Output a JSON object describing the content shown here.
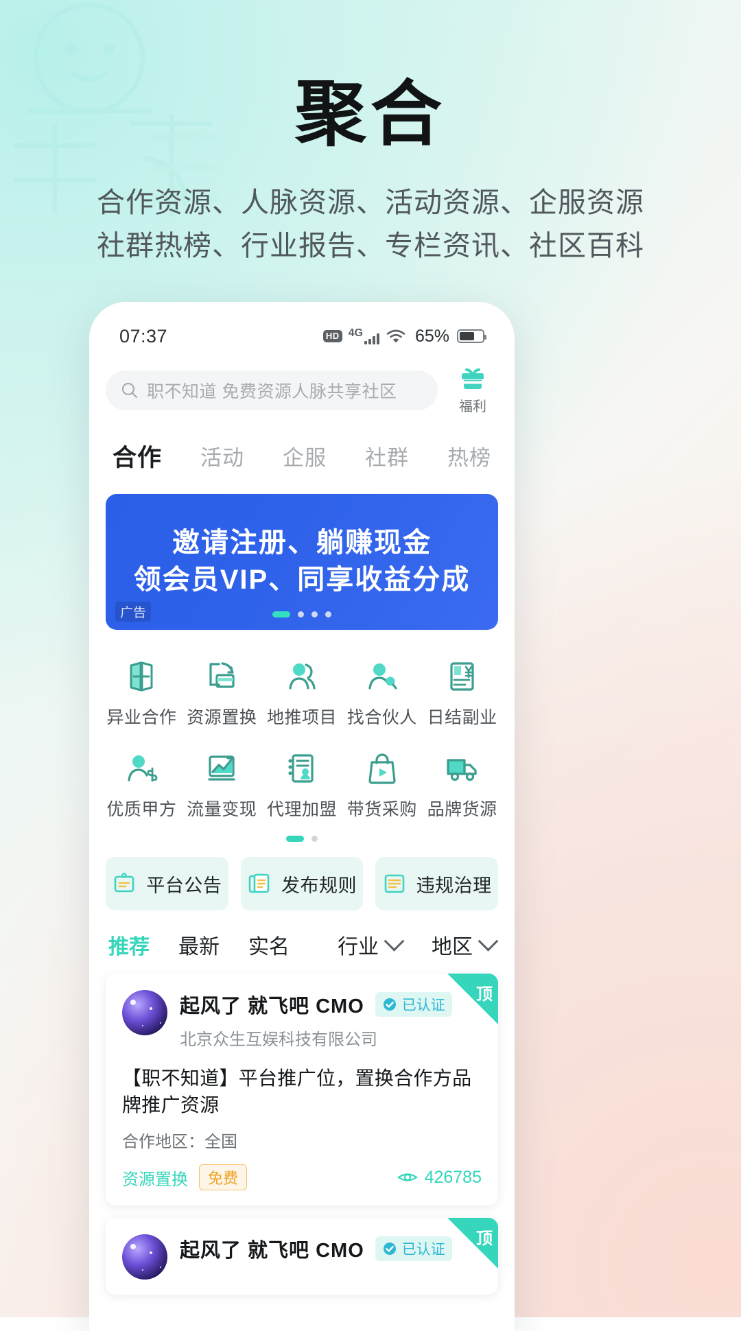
{
  "hero": {
    "title": "聚合",
    "subtitle_line1": "合作资源、人脉资源、活动资源、企服资源",
    "subtitle_line2": "社群热榜、行业报告、专栏资讯、社区百科"
  },
  "statusbar": {
    "time": "07:37",
    "hd": "HD",
    "network": "4G",
    "battery_percent": "65%"
  },
  "search": {
    "placeholder": "职不知道 免费资源人脉共享社区",
    "welfare_label": "福利"
  },
  "tabs": [
    {
      "label": "合作",
      "active": true
    },
    {
      "label": "活动",
      "active": false
    },
    {
      "label": "企服",
      "active": false
    },
    {
      "label": "社群",
      "active": false
    },
    {
      "label": "热榜",
      "active": false
    }
  ],
  "banner": {
    "line1": "邀请注册、躺赚现金",
    "line2": "领会员VIP、同享收益分成",
    "ad_tag": "广告",
    "dots": 4,
    "active_dot": 0,
    "bg_color": "#2f62ea"
  },
  "grid": {
    "items": [
      {
        "label": "异业合作",
        "icon": "exchange-flag-icon"
      },
      {
        "label": "资源置换",
        "icon": "swap-card-icon"
      },
      {
        "label": "地推项目",
        "icon": "two-people-icon"
      },
      {
        "label": "找合伙人",
        "icon": "person-search-icon"
      },
      {
        "label": "日结副业",
        "icon": "yen-note-icon"
      },
      {
        "label": "优质甲方",
        "icon": "person-dollar-icon"
      },
      {
        "label": "流量变现",
        "icon": "trend-chart-icon"
      },
      {
        "label": "代理加盟",
        "icon": "resume-person-icon"
      },
      {
        "label": "带货采购",
        "icon": "shop-bag-play-icon"
      },
      {
        "label": "品牌货源",
        "icon": "truck-icon"
      }
    ],
    "pages": 2,
    "active_page": 0,
    "accent_color": "#35d6bb"
  },
  "quick_links": [
    {
      "label": "平台公告",
      "icon": "clipboard-icon"
    },
    {
      "label": "发布规则",
      "icon": "documents-icon"
    },
    {
      "label": "违规治理",
      "icon": "list-doc-icon"
    }
  ],
  "filter": {
    "sorts": [
      {
        "label": "推荐",
        "active": true
      },
      {
        "label": "最新",
        "active": false
      },
      {
        "label": "实名",
        "active": false
      }
    ],
    "dropdowns": [
      {
        "label": "行业"
      },
      {
        "label": "地区"
      }
    ]
  },
  "posts": [
    {
      "corner_badge": "顶",
      "username": "起风了 就飞吧  CMO",
      "verified_label": "已认证",
      "company": "北京众生互娱科技有限公司",
      "title": "【职不知道】平台推广位，置换合作方品牌推广资源",
      "region": "合作地区：全国",
      "tag": "资源置换",
      "price_tag": "免费",
      "views": "426785"
    },
    {
      "corner_badge": "顶",
      "username": "起风了 就飞吧  CMO",
      "verified_label": "已认证",
      "company": "",
      "title": "",
      "region": "",
      "tag": "",
      "price_tag": "",
      "views": ""
    }
  ]
}
